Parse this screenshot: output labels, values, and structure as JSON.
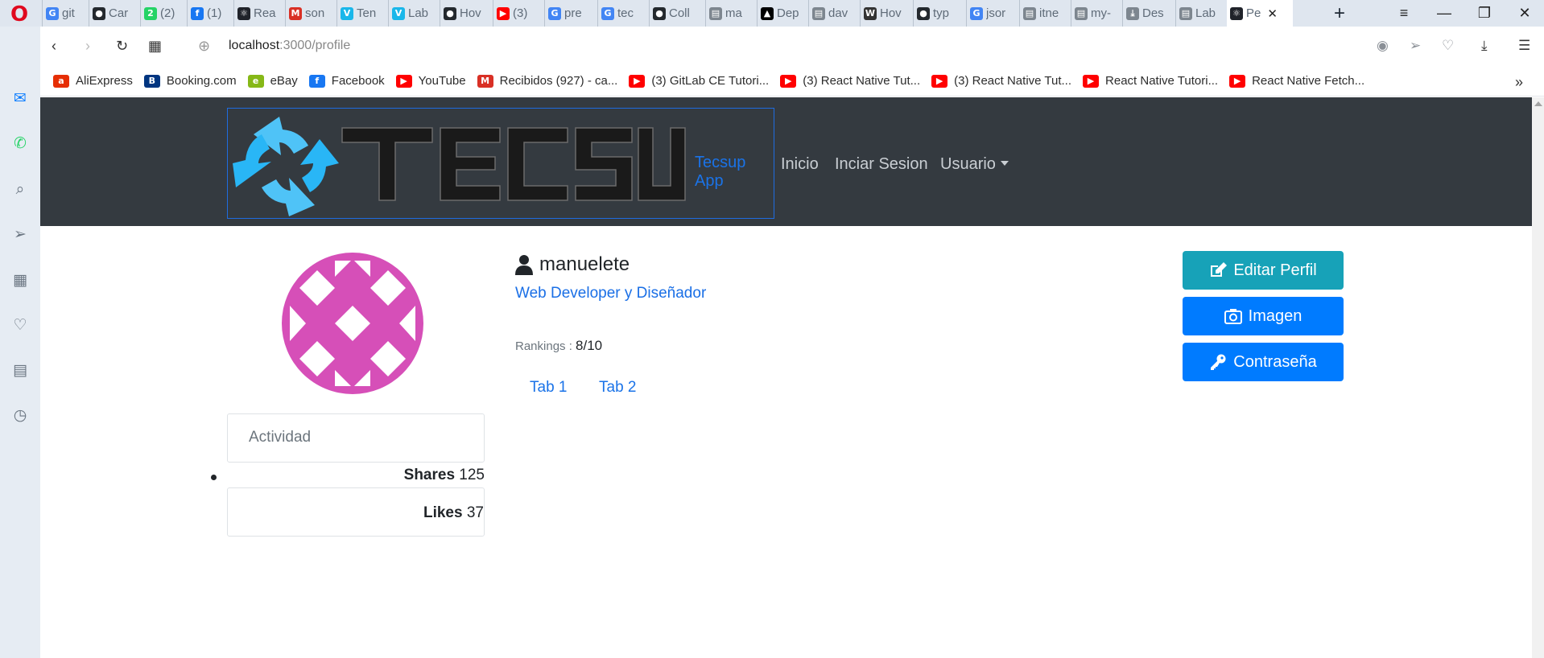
{
  "browser": {
    "tabs": [
      {
        "title": "git",
        "icon": "google-icon",
        "color": "#4285f4",
        "glyph": "G"
      },
      {
        "title": "Car",
        "icon": "github-icon",
        "color": "#24292e",
        "glyph": "●"
      },
      {
        "title": "(2)",
        "icon": "whatsapp-badge-icon",
        "color": "#25d366",
        "glyph": "2"
      },
      {
        "title": "(1)",
        "icon": "facebook-icon",
        "color": "#1877f2",
        "glyph": "f"
      },
      {
        "title": "Rea",
        "icon": "react-icon",
        "color": "#20232a",
        "glyph": "⚛"
      },
      {
        "title": "son",
        "icon": "gmail-icon",
        "color": "#d93025",
        "glyph": "M"
      },
      {
        "title": "Ten",
        "icon": "vimeo-icon",
        "color": "#1ab7ea",
        "glyph": "V"
      },
      {
        "title": "Lab",
        "icon": "vimeo-icon",
        "color": "#1ab7ea",
        "glyph": "V"
      },
      {
        "title": "Hov",
        "icon": "github-icon",
        "color": "#24292e",
        "glyph": "●"
      },
      {
        "title": "(3)",
        "icon": "youtube-icon",
        "color": "#ff0000",
        "glyph": "▶"
      },
      {
        "title": "pre",
        "icon": "google-icon",
        "color": "#4285f4",
        "glyph": "G"
      },
      {
        "title": "tec",
        "icon": "google-icon",
        "color": "#4285f4",
        "glyph": "G"
      },
      {
        "title": "Coll",
        "icon": "github-icon",
        "color": "#24292e",
        "glyph": "●"
      },
      {
        "title": "ma",
        "icon": "file-icon",
        "color": "#7d868f",
        "glyph": "▤"
      },
      {
        "title": "Dep",
        "icon": "vercel-icon",
        "color": "#000000",
        "glyph": "▲"
      },
      {
        "title": "dav",
        "icon": "file-icon",
        "color": "#7d868f",
        "glyph": "▤"
      },
      {
        "title": "Hov",
        "icon": "wikipedia-icon",
        "color": "#333333",
        "glyph": "W"
      },
      {
        "title": "typ",
        "icon": "github-icon",
        "color": "#24292e",
        "glyph": "●"
      },
      {
        "title": "jsor",
        "icon": "google-icon",
        "color": "#4285f4",
        "glyph": "G"
      },
      {
        "title": "itne",
        "icon": "file-icon",
        "color": "#7d868f",
        "glyph": "▤"
      },
      {
        "title": "my-",
        "icon": "file-icon",
        "color": "#7d868f",
        "glyph": "▤"
      },
      {
        "title": "Des",
        "icon": "download-icon",
        "color": "#7d868f",
        "glyph": "⤓"
      },
      {
        "title": "Lab",
        "icon": "file-icon",
        "color": "#7d868f",
        "glyph": "▤"
      },
      {
        "title": "Pe",
        "icon": "react-icon",
        "color": "#20232a",
        "glyph": "⚛",
        "active": true
      }
    ],
    "url_host": "localhost",
    "url_path": ":3000/profile",
    "bookmarks": [
      {
        "label": "AliExpress",
        "icon": "aliexpress-icon",
        "color": "#e62e04",
        "glyph": "a"
      },
      {
        "label": "Booking.com",
        "icon": "booking-icon",
        "color": "#003580",
        "glyph": "B"
      },
      {
        "label": "eBay",
        "icon": "ebay-icon",
        "color": "#86b817",
        "glyph": "e"
      },
      {
        "label": "Facebook",
        "icon": "facebook-icon",
        "color": "#1877f2",
        "glyph": "f"
      },
      {
        "label": "YouTube",
        "icon": "youtube-icon",
        "color": "#ff0000",
        "glyph": "▶"
      },
      {
        "label": "Recibidos (927) - ca...",
        "icon": "gmail-icon",
        "color": "#d93025",
        "glyph": "M"
      },
      {
        "label": "(3) GitLab CE Tutori...",
        "icon": "youtube-icon",
        "color": "#ff0000",
        "glyph": "▶"
      },
      {
        "label": "(3) React Native Tut...",
        "icon": "youtube-icon",
        "color": "#ff0000",
        "glyph": "▶"
      },
      {
        "label": "(3) React Native Tut...",
        "icon": "youtube-icon",
        "color": "#ff0000",
        "glyph": "▶"
      },
      {
        "label": "React Native Tutori...",
        "icon": "youtube-icon",
        "color": "#ff0000",
        "glyph": "▶"
      },
      {
        "label": "React Native Fetch...",
        "icon": "youtube-icon",
        "color": "#ff0000",
        "glyph": "▶"
      }
    ]
  },
  "site": {
    "brand": "Tecsup App",
    "nav": {
      "inicio": "Inicio",
      "login": "Inciar Sesion",
      "usuario": "Usuario"
    }
  },
  "profile": {
    "username": "manuelete",
    "role": "Web Developer y Diseñador",
    "rankings_label": "Rankings :",
    "rankings_value": "8/10",
    "tabs": [
      "Tab 1",
      "Tab 2"
    ],
    "buttons": {
      "edit": "Editar Perfil",
      "image": "Imagen",
      "password": "Contraseña"
    },
    "activity_title": "Actividad",
    "shares_label": "Shares",
    "shares_value": "125",
    "likes_label": "Likes",
    "likes_value": "37"
  },
  "colors": {
    "navbar": "#343a40",
    "info": "#17a2b8",
    "primary": "#007bff",
    "avatar": "#d64fb8"
  }
}
